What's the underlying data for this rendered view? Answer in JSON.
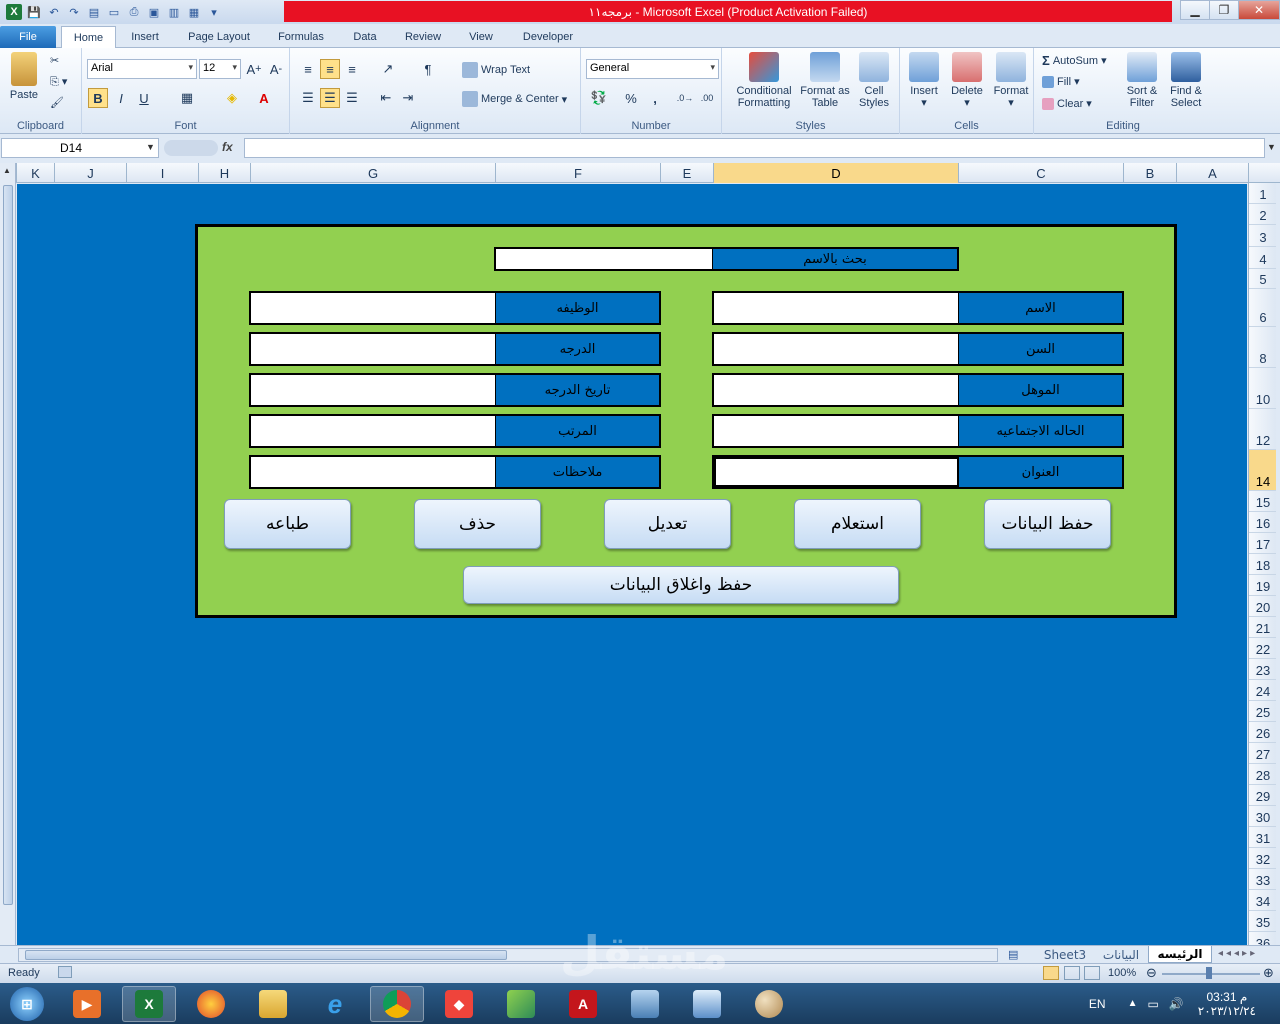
{
  "window": {
    "title": "برمجه١١  -  Microsoft Excel (Product Activation Failed)"
  },
  "tabs": [
    "File",
    "Home",
    "Insert",
    "Page Layout",
    "Formulas",
    "Data",
    "Review",
    "View",
    "Developer"
  ],
  "ribbon": {
    "clipboard": {
      "label": "Clipboard",
      "paste": "Paste"
    },
    "font": {
      "label": "Font",
      "name": "Arial",
      "size": "12",
      "bold": "B",
      "italic": "I",
      "underline": "U"
    },
    "alignment": {
      "label": "Alignment",
      "wrap": "Wrap Text",
      "merge": "Merge & Center"
    },
    "number": {
      "label": "Number",
      "format": "General",
      "percent": "%",
      "comma": ","
    },
    "styles": {
      "label": "Styles",
      "conditional": "Conditional Formatting",
      "format_table": "Format as Table",
      "cell_styles": "Cell Styles"
    },
    "cells": {
      "label": "Cells",
      "insert": "Insert",
      "delete": "Delete",
      "format": "Format"
    },
    "editing": {
      "label": "Editing",
      "autosum": "AutoSum",
      "fill": "Fill",
      "clear": "Clear",
      "sort": "Sort & Filter",
      "find": "Find & Select"
    }
  },
  "formula_bar": {
    "name_box": "D14",
    "fx": "fx",
    "value": ""
  },
  "columns": [
    "K",
    "J",
    "I",
    "H",
    "G",
    "F",
    "E",
    "D",
    "C",
    "B",
    "A"
  ],
  "selected_column": "D",
  "rows": [
    "1",
    "2",
    "3",
    "4",
    "5",
    "6",
    "8",
    "10",
    "12",
    "14",
    "15",
    "16",
    "17",
    "18",
    "19",
    "20",
    "21",
    "22",
    "23",
    "24",
    "25",
    "26",
    "27",
    "28",
    "29",
    "30",
    "31",
    "32",
    "33",
    "34",
    "35",
    "36"
  ],
  "selected_row": "14",
  "form": {
    "search_label": "بحث بالاسم",
    "right_fields": [
      "الاسم",
      "السن",
      "الموهل",
      "الحاله الاجتماعيه",
      "العنوان"
    ],
    "left_fields": [
      "الوظيفه",
      "الدرجه",
      "تاريخ الدرجه",
      "المرتب",
      "ملاحظات"
    ],
    "buttons": [
      "حفظ البيانات",
      "استعلام",
      "تعديل",
      "حذف",
      "طباعه"
    ],
    "save_close": "حفظ واغلاق البيانات"
  },
  "sheet_tabs": [
    "الرئيسه",
    "البيانات",
    "Sheet3"
  ],
  "active_sheet": "الرئيسه",
  "status": {
    "ready": "Ready",
    "zoom": "100%"
  },
  "taskbar": {
    "apps": [
      "start-orb",
      "media-player",
      "excel",
      "firefox",
      "file-explorer",
      "internet-explorer",
      "chrome",
      "anydesk",
      "puzzle-app",
      "acrobat",
      "network-monitor",
      "remote-desktop",
      "paint"
    ],
    "lang": "EN",
    "time": "03:31 م",
    "date": "٢٠٢٣/١٢/٢٤"
  },
  "watermark": "مستقل",
  "colors": {
    "sheet_bg": "#0070c0",
    "panel_bg": "#92d050",
    "label_bg": "#0070c0"
  }
}
